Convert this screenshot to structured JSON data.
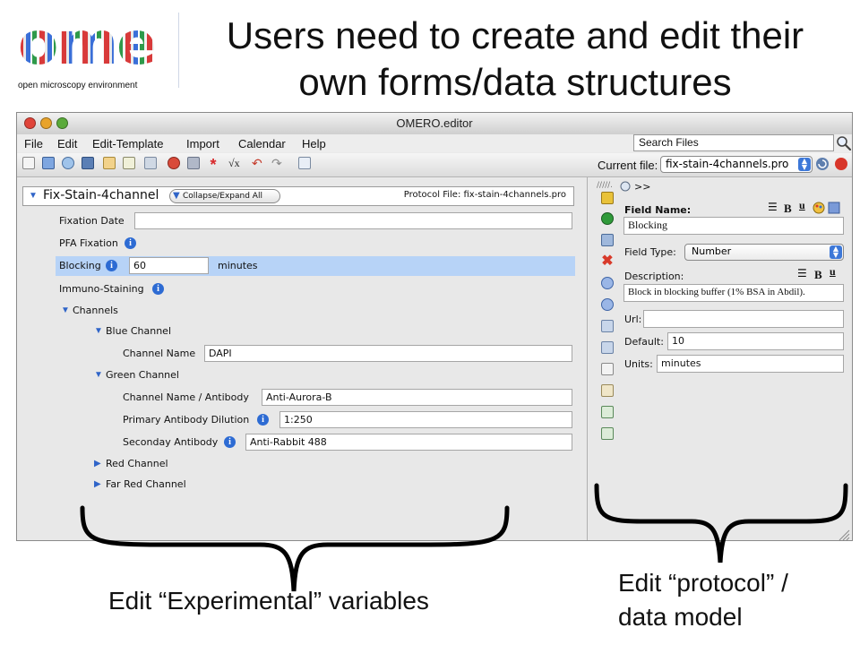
{
  "slide": {
    "title_line1": "Users need to create and edit their",
    "title_line2": "own forms/data structures"
  },
  "logo": {
    "letters": "ome",
    "tagline": "open microscopy environment"
  },
  "window": {
    "title": "OMERO.editor",
    "menu": [
      "File",
      "Edit",
      "Edit-Template",
      "Import",
      "Calendar",
      "Help"
    ],
    "search_placeholder": "Search Files",
    "current_file_label": "Current file:",
    "current_file_value": "fix-stain-4channels.pro"
  },
  "protocol": {
    "name": "Fix-Stain-4channel",
    "collapse_label": "Collapse/Expand All",
    "file_label": "Protocol File: fix-stain-4channels.pro",
    "fields": {
      "fixation_date_label": "Fixation Date",
      "fixation_date_value": "",
      "pfa_label": "PFA Fixation",
      "blocking_label": "Blocking",
      "blocking_value": "60",
      "blocking_units": "minutes",
      "immuno_label": "Immuno-Staining",
      "channels_label": "Channels",
      "blue_label": "Blue Channel",
      "blue_channel_name_label": "Channel Name",
      "blue_channel_name_value": "DAPI",
      "green_label": "Green Channel",
      "green_name_label": "Channel Name / Antibody",
      "green_name_value": "Anti-Aurora-B",
      "primary_dilution_label": "Primary Antibody Dilution",
      "primary_dilution_value": "1:250",
      "secondary_label": "Seconday Antibody",
      "secondary_value": "Anti-Rabbit 488",
      "red_label": "Red Channel",
      "far_red_label": "Far Red Channel"
    }
  },
  "editor": {
    "breadcrumb": ">>",
    "field_name_label": "Field Name:",
    "field_name_value": "Blocking",
    "field_type_label": "Field Type:",
    "field_type_value": "Number",
    "description_label": "Description:",
    "description_value": "Block in blocking buffer (1% BSA in Abdil).",
    "url_label": "Url:",
    "url_value": "",
    "default_label": "Default:",
    "default_value": "10",
    "units_label": "Units:",
    "units_value": "minutes",
    "format_bold": "B",
    "format_underline": "u"
  },
  "annotations": {
    "experimental": "Edit “Experimental” variables",
    "protocol_line1": "Edit “protocol” /",
    "protocol_line2": "data model"
  }
}
